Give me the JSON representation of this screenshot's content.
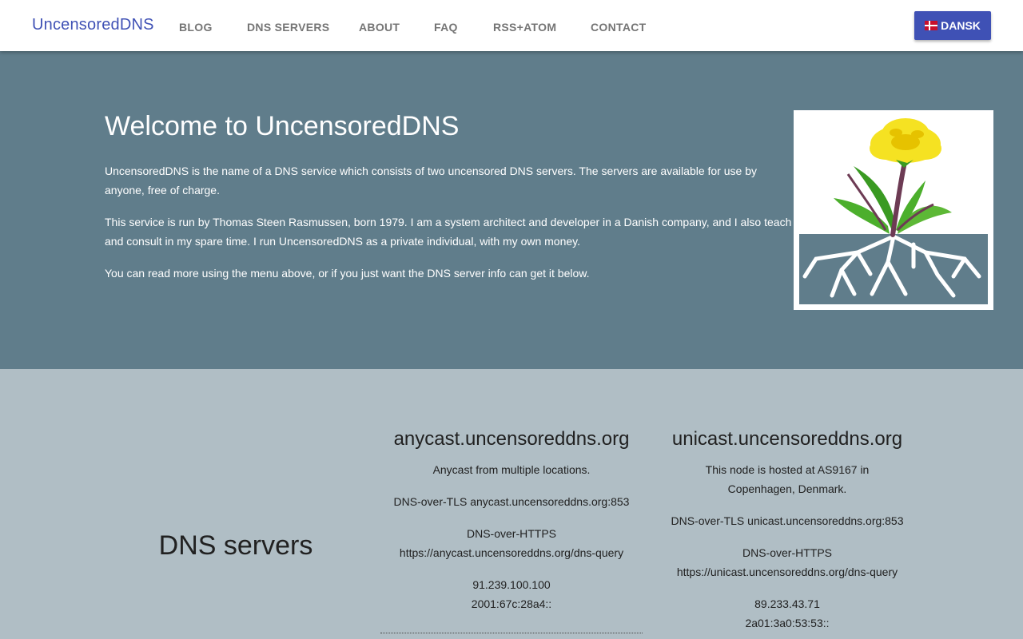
{
  "nav": {
    "brand": "UncensoredDNS",
    "items": [
      "BLOG",
      "DNS SERVERS",
      "ABOUT",
      "FAQ",
      "RSS+ATOM",
      "CONTACT"
    ],
    "language_button": "DANSK"
  },
  "hero": {
    "title": "Welcome to UncensoredDNS",
    "p1": "UncensoredDNS is the name of a DNS service which consists of two uncensored DNS servers. The servers are available for use by anyone, free of charge.",
    "p2": "This service is run by Thomas Steen Rasmussen, born 1979. I am a system architect and developer in a Danish company, and I also teach and consult in my spare time. I run UncensoredDNS as a private individual, with my own money.",
    "p3": "You can read more using the menu above, or if you just want the DNS server info can get it below."
  },
  "servers": {
    "title": "DNS servers",
    "anycast": {
      "heading": "anycast.uncensoreddns.org",
      "desc": "Anycast from multiple locations.",
      "tls": "DNS-over-TLS anycast.uncensoreddns.org:853",
      "https_label": "DNS-over-HTTPS",
      "https_url": "https://anycast.uncensoreddns.org/dns-query",
      "ipv4": "91.239.100.100",
      "ipv6": "2001:67c:28a4::"
    },
    "unicast": {
      "heading": "unicast.uncensoreddns.org",
      "desc": "This node is hosted at AS9167 in Copenhagen, Denmark.",
      "tls": "DNS-over-TLS unicast.uncensoreddns.org:853",
      "https_label": "DNS-over-HTTPS",
      "https_url": "https://unicast.uncensoreddns.org/dns-query",
      "ipv4": "89.233.43.71",
      "ipv6": "2a01:3a0:53:53::"
    }
  },
  "colors": {
    "primary": "#3f51b5",
    "hero_bg": "#607d8b",
    "section_bg": "#b0bec5",
    "flag_red": "#c8102e"
  },
  "icons": [
    "denmark-flag-icon",
    "dandelion-logo"
  ]
}
